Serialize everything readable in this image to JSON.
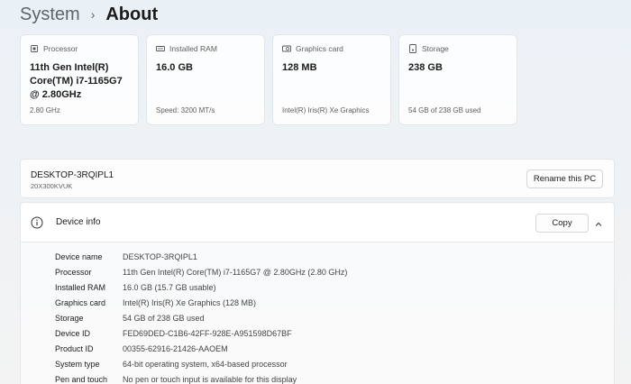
{
  "breadcrumb": {
    "parent": "System",
    "separator": "›",
    "current": "About"
  },
  "cards": [
    {
      "icon": "processor-icon",
      "label": "Processor",
      "value": "11th Gen Intel(R) Core(TM) i7-1165G7 @ 2.80GHz",
      "sub": "2.80 GHz"
    },
    {
      "icon": "ram-icon",
      "label": "Installed RAM",
      "value": "16.0 GB",
      "sub": "Speed: 3200 MT/s"
    },
    {
      "icon": "graphics-card-icon",
      "label": "Graphics card",
      "value": "128 MB",
      "sub": "Intel(R) Iris(R) Xe Graphics"
    },
    {
      "icon": "storage-icon",
      "label": "Storage",
      "value": "238 GB",
      "sub": "54 GB of 238 GB used"
    }
  ],
  "pc": {
    "name": "DESKTOP-3RQIPL1",
    "model": "20X300KVUK",
    "rename_label": "Rename this PC"
  },
  "device_info": {
    "title": "Device info",
    "copy_label": "Copy",
    "rows": [
      {
        "key": "Device name",
        "value": "DESKTOP-3RQIPL1"
      },
      {
        "key": "Processor",
        "value": "11th Gen Intel(R) Core(TM) i7-1165G7 @ 2.80GHz (2.80 GHz)"
      },
      {
        "key": "Installed RAM",
        "value": "16.0 GB (15.7 GB usable)"
      },
      {
        "key": "Graphics card",
        "value": "Intel(R) Iris(R) Xe Graphics (128 MB)"
      },
      {
        "key": "Storage",
        "value": "54 GB of 238 GB used"
      },
      {
        "key": "Device ID",
        "value": "FED69DED-C1B6-42FF-928E-A951598D67BF"
      },
      {
        "key": "Product ID",
        "value": "00355-62916-21426-AAOEM"
      },
      {
        "key": "System type",
        "value": "64-bit operating system, x64-based processor"
      },
      {
        "key": "Pen and touch",
        "value": "No pen or touch input is available for this display"
      }
    ]
  }
}
